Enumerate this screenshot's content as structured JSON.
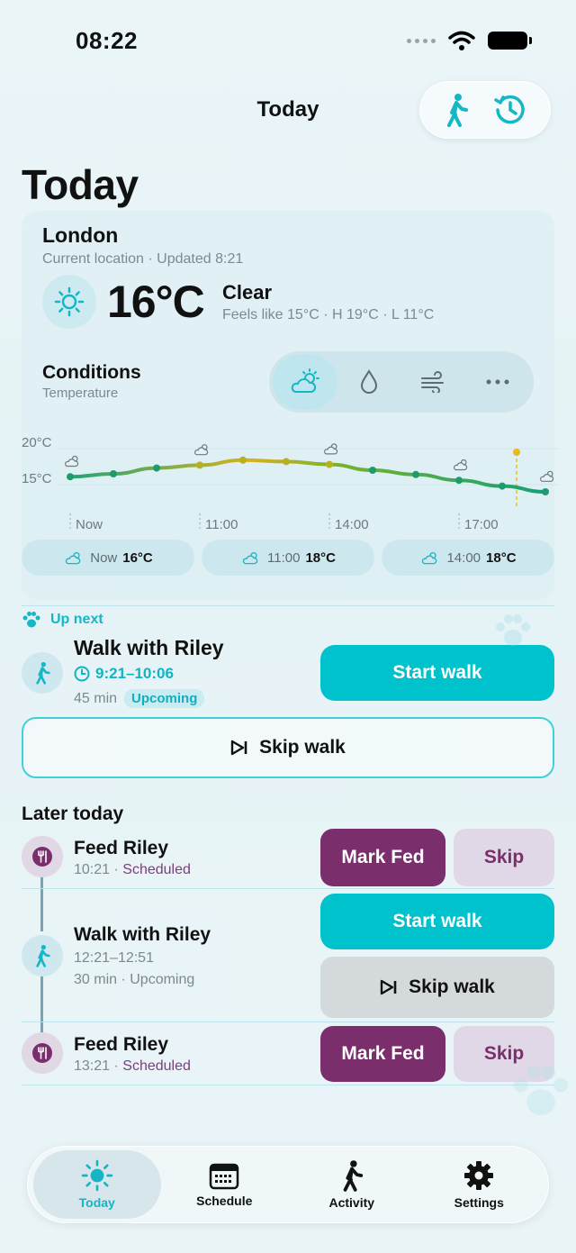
{
  "status": {
    "time": "08:22"
  },
  "nav": {
    "title": "Today"
  },
  "page": {
    "title": "Today"
  },
  "weather": {
    "city": "London",
    "subtitle": "Current location · Updated 8:21",
    "temperature": "16°C",
    "condition": "Clear",
    "details": "Feels like 15°C · H 19°C · L 11°C"
  },
  "conditions": {
    "title": "Conditions",
    "subtitle": "Temperature",
    "metrics": [
      "temperature",
      "precipitation",
      "wind",
      "more"
    ],
    "active_metric": "temperature"
  },
  "chart_data": {
    "type": "line",
    "y_tick_labels": [
      "20°C",
      "15°C"
    ],
    "x_tick_labels": [
      "Now",
      "11:00",
      "14:00",
      "17:00"
    ],
    "ylim": [
      12,
      22
    ],
    "x": [
      "Now",
      "",
      "",
      "11:00",
      "",
      "",
      "14:00",
      "",
      "",
      "17:00",
      "",
      ""
    ],
    "values": [
      16.1,
      16.5,
      17.3,
      17.7,
      18.4,
      18.2,
      17.8,
      17.0,
      16.4,
      15.6,
      14.8,
      14.0
    ],
    "series": [
      {
        "values": [
          16.1,
          16.5,
          17.3,
          17.7,
          18.4,
          18.2,
          17.8,
          17.0,
          16.4,
          15.6,
          14.8,
          14.0
        ]
      }
    ],
    "colors": {
      "line_start": "#22a37a",
      "line_peak": "#e0b020",
      "line_end": "#12a07a"
    }
  },
  "forecast": [
    {
      "time": "Now",
      "temp": "16°C"
    },
    {
      "time": "11:00",
      "temp": "18°C"
    },
    {
      "time": "14:00",
      "temp": "18°C"
    }
  ],
  "up_next": {
    "label": "Up next",
    "title": "Walk with Riley",
    "time": "9:21–10:06",
    "duration": "45 min",
    "badge": "Upcoming",
    "start_label": "Start walk",
    "skip_label": "Skip walk"
  },
  "later": {
    "title": "Later today",
    "items": [
      {
        "title": "Feed Riley",
        "time": "10:21 · ",
        "status": "Scheduled",
        "primary": "Mark Fed",
        "secondary": "Skip"
      },
      {
        "title": "Walk with Riley",
        "time": "12:21–12:51",
        "extra": "30 min · Upcoming",
        "primary": "Start walk",
        "secondary": "Skip walk"
      },
      {
        "title": "Feed Riley",
        "time": "13:21 · ",
        "status": "Scheduled",
        "primary": "Mark Fed",
        "secondary": "Skip"
      }
    ]
  },
  "tabs": [
    {
      "label": "Today",
      "icon": "sun-icon"
    },
    {
      "label": "Schedule",
      "icon": "calendar-icon"
    },
    {
      "label": "Activity",
      "icon": "walk-icon"
    },
    {
      "label": "Settings",
      "icon": "gear-icon"
    }
  ],
  "colors": {
    "accent": "#00c2cc",
    "plum": "#7a2f6c"
  }
}
